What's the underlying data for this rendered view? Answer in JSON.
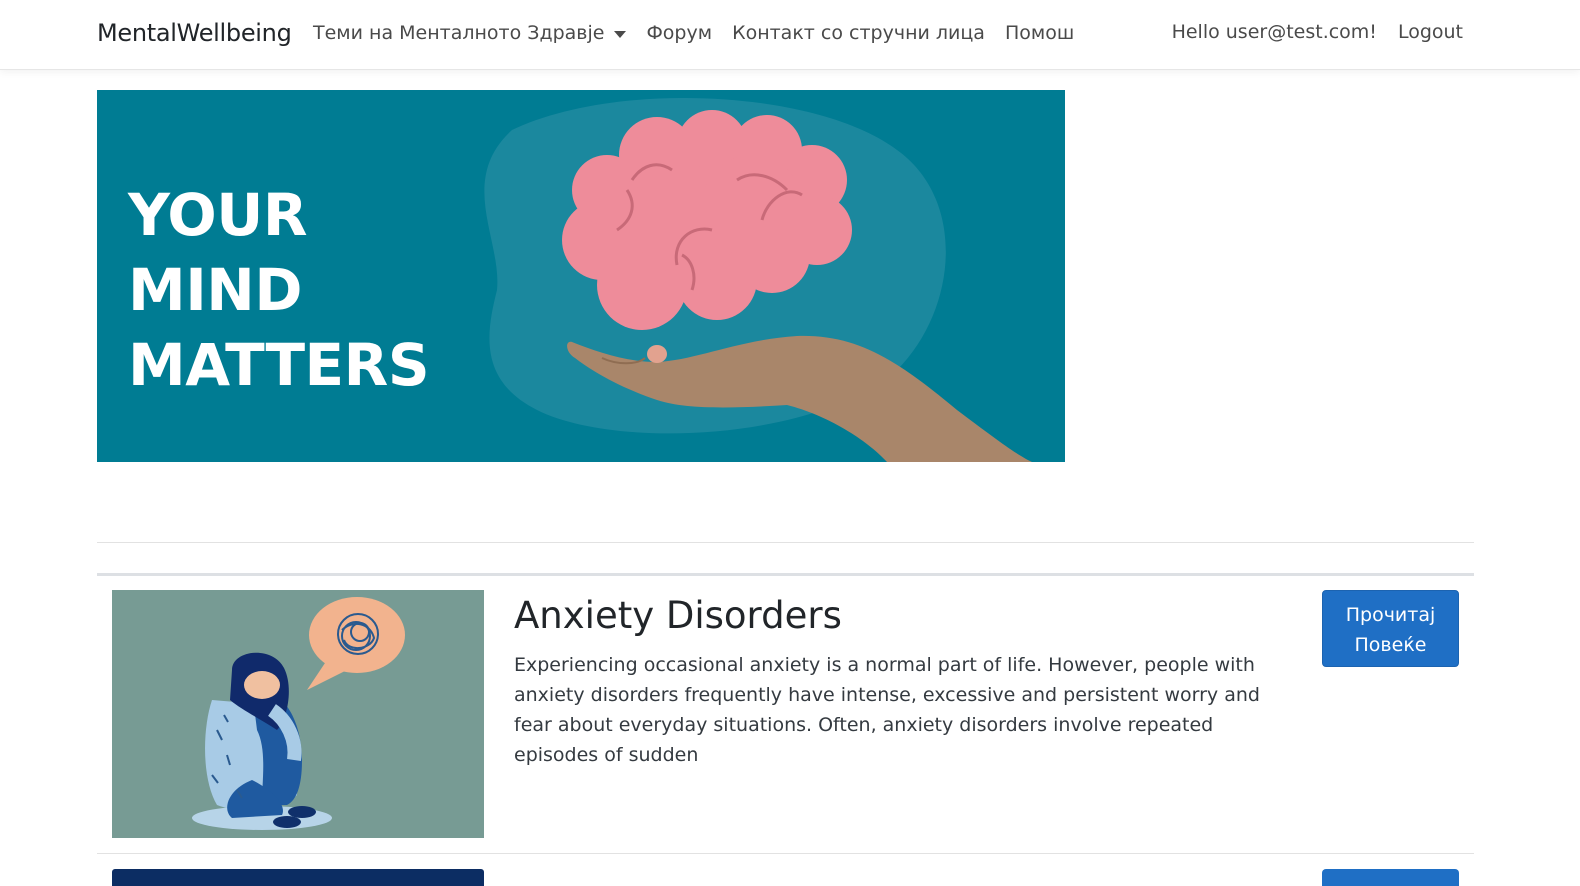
{
  "navbar": {
    "brand": "MentalWellbeing",
    "links": [
      {
        "label": "Теми на Менталното Здравје",
        "dropdown": true
      },
      {
        "label": "Форум"
      },
      {
        "label": "Контакт со стручни лица"
      },
      {
        "label": "Помош"
      }
    ],
    "greeting": "Hello user@test.com!",
    "logout": "Logout"
  },
  "hero": {
    "lines": [
      "YOUR",
      "MIND",
      "MATTERS"
    ],
    "background_color": "#007c93",
    "icons": [
      "brain-icon",
      "open-hand-icon"
    ]
  },
  "topics": [
    {
      "title": "Anxiety Disorders",
      "description": "Experiencing occasional anxiety is a normal part of life. However, people with anxiety disorders frequently have intense, excessive and persistent worry and fear about everyday situations. Often, anxiety disorders involve repeated episodes of sudden",
      "button_line1": "Прочитај",
      "button_line2": "Повеќе",
      "image_background": "#779b94"
    }
  ],
  "colors": {
    "primary_button": "#1f6fc5",
    "next_card_image": "#0c2d63"
  }
}
